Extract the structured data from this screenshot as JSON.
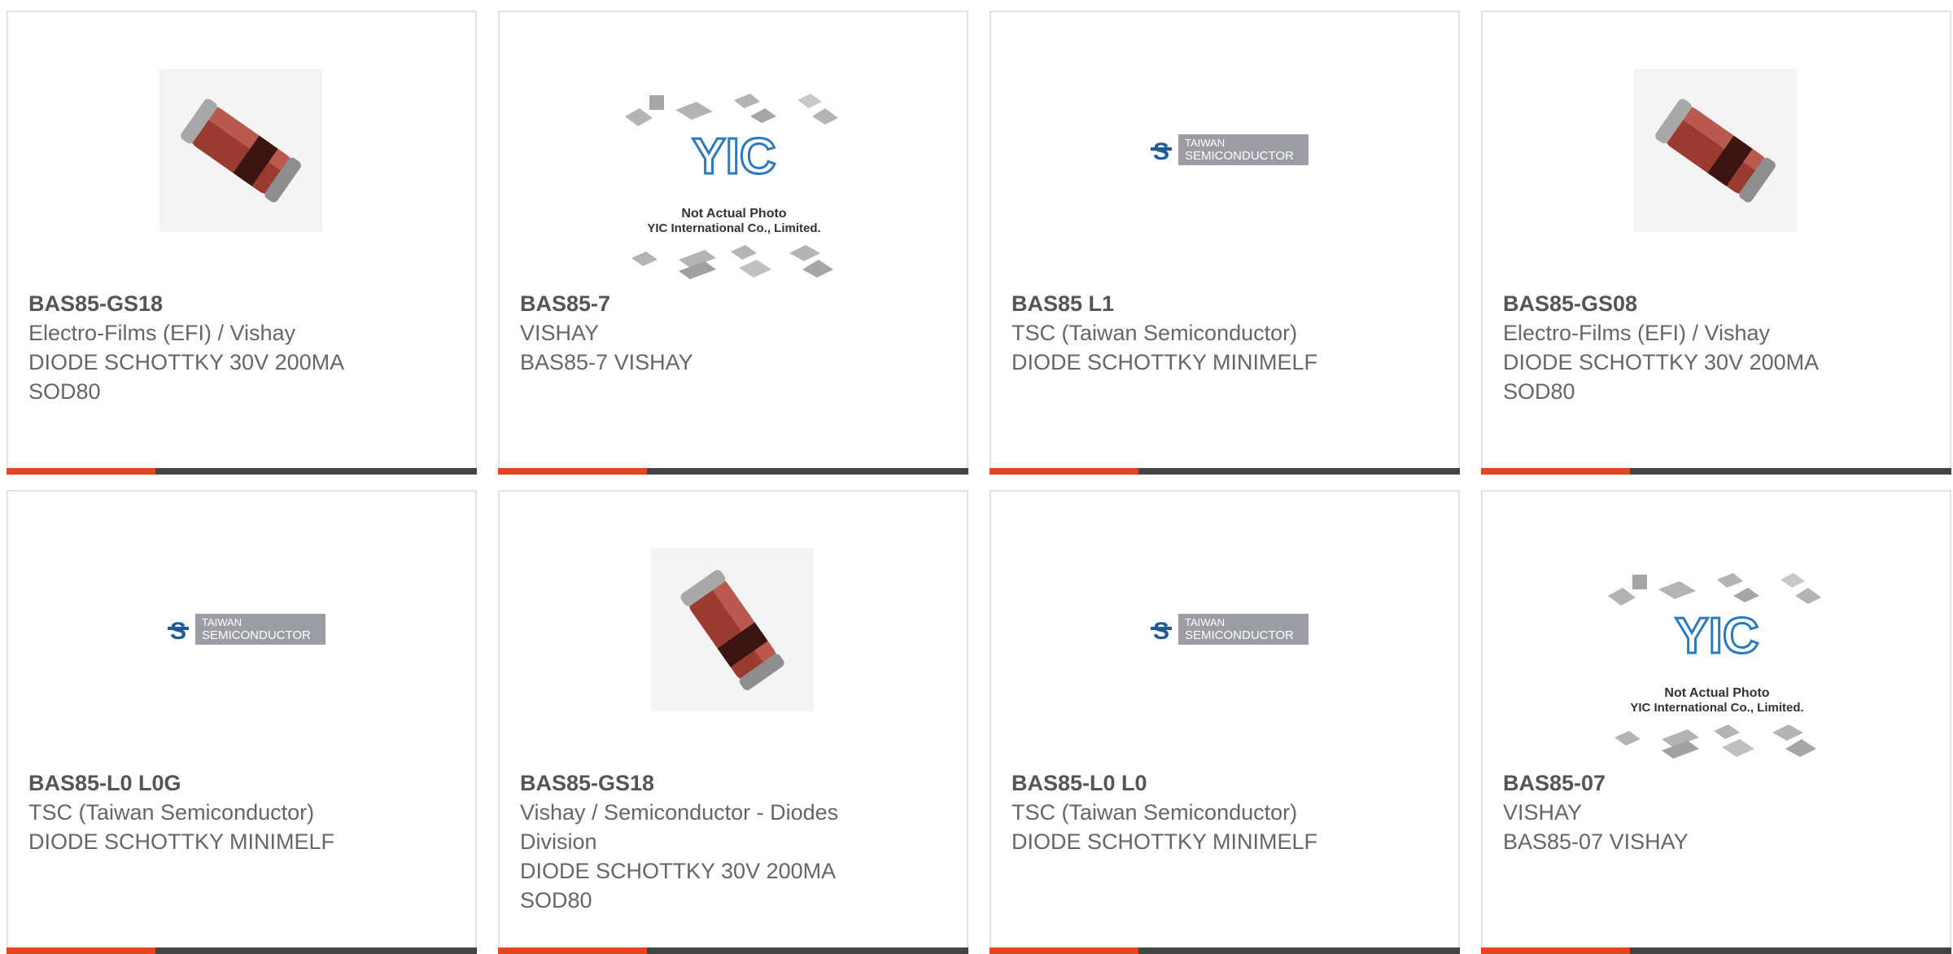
{
  "colors": {
    "accent": "#e8451e",
    "bar_dark": "#444446",
    "border": "#e2e2e2"
  },
  "image_text": {
    "tsc_line1": "TAIWAN",
    "tsc_line2": "SEMICONDUCTOR",
    "yic_logo": "YIC",
    "yic_line1": "Not Actual Photo",
    "yic_line2": "YIC International Co., Limited."
  },
  "cards": [
    {
      "image": "diode-photo",
      "part": "BAS85-GS18",
      "mfr": "Electro-Films (EFI) / Vishay",
      "desc": "DIODE SCHOTTKY 30V 200MA\nSOD80"
    },
    {
      "image": "yic-placeholder",
      "part": "BAS85-7",
      "mfr": "VISHAY",
      "desc": "BAS85-7 VISHAY"
    },
    {
      "image": "tsc-logo",
      "part": "BAS85 L1",
      "mfr": "TSC (Taiwan Semiconductor)",
      "desc": "DIODE SCHOTTKY MINIMELF"
    },
    {
      "image": "diode-photo",
      "part": "BAS85-GS08",
      "mfr": "Electro-Films (EFI) / Vishay",
      "desc": "DIODE SCHOTTKY 30V 200MA\nSOD80"
    },
    {
      "image": "tsc-logo",
      "part": "BAS85-L0 L0G",
      "mfr": "TSC (Taiwan Semiconductor)",
      "desc": "DIODE SCHOTTKY MINIMELF"
    },
    {
      "image": "diode-photo",
      "part": "BAS85-GS18",
      "mfr": "Vishay / Semiconductor - Diodes\nDivision",
      "desc": "DIODE SCHOTTKY 30V 200MA\nSOD80"
    },
    {
      "image": "tsc-logo",
      "part": "BAS85-L0 L0",
      "mfr": "TSC (Taiwan Semiconductor)",
      "desc": "DIODE SCHOTTKY MINIMELF"
    },
    {
      "image": "yic-placeholder",
      "part": "BAS85-07",
      "mfr": "VISHAY",
      "desc": "BAS85-07 VISHAY"
    }
  ]
}
